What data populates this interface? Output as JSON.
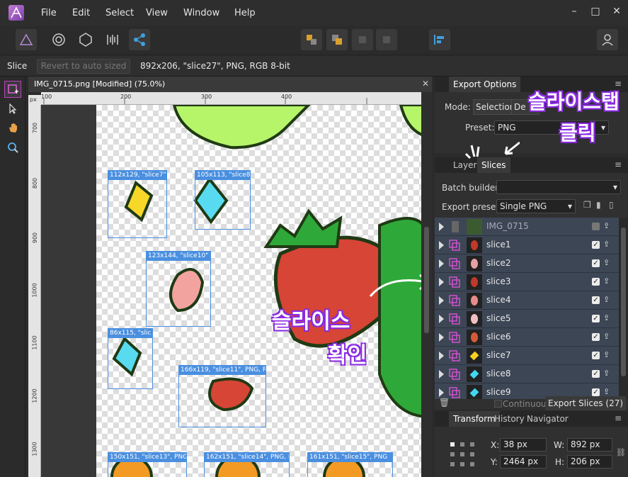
{
  "menu": {
    "items": [
      "File",
      "Edit",
      "Select",
      "View",
      "Window",
      "Help"
    ],
    "window_controls": [
      "–",
      "□",
      "✕"
    ]
  },
  "context": {
    "tool_name": "Slice",
    "revert_label": "Revert to auto sized",
    "info": "892x206, \"slice27\", PNG, RGB 8-bit"
  },
  "document": {
    "tab_title": "IMG_0715.png [Modified] (75.0%)",
    "close_glyph": "✕",
    "ruler_unit": "px",
    "ruler_top": [
      "100",
      "200",
      "300",
      "400"
    ],
    "ruler_left": [
      "700",
      "800",
      "900",
      "1000",
      "1100",
      "1200",
      "1300"
    ],
    "slices": [
      {
        "label": "112x129, \"slice7\""
      },
      {
        "label": "105x113, \"slice8\""
      },
      {
        "label": "123x144, \"slice10\""
      },
      {
        "label": "86x115, \"slic"
      },
      {
        "label": "166x119, \"slice11\", PNG, R"
      },
      {
        "label": "150x151, \"slice13\", PNG"
      },
      {
        "label": "162x151, \"slice14\", PNG, F"
      },
      {
        "label": "161x151, \"slice15\", PNG"
      }
    ]
  },
  "export_options": {
    "tab": "Export Options",
    "mode_label": "Mode:",
    "mode_value": "Selection",
    "mode_value2": "De",
    "preset_label": "Preset:",
    "preset_value": "PNG"
  },
  "slices_panel": {
    "tabs": [
      "Layers",
      "Slices"
    ],
    "batch_label": "Batch builder:",
    "export_preset_label": "Export preset:",
    "export_preset_value": "Single PNG",
    "rows": [
      {
        "name": "IMG_0715",
        "checked": false,
        "color": "#666"
      },
      {
        "name": "slice1",
        "checked": true,
        "color": "#c0392b"
      },
      {
        "name": "slice2",
        "checked": true,
        "color": "#e8a0a0"
      },
      {
        "name": "slice3",
        "checked": true,
        "color": "#c0392b"
      },
      {
        "name": "slice4",
        "checked": true,
        "color": "#e88a8a"
      },
      {
        "name": "slice5",
        "checked": true,
        "color": "#f0c0c0"
      },
      {
        "name": "slice6",
        "checked": true,
        "color": "#d45a3a"
      },
      {
        "name": "slice7",
        "checked": true,
        "color": "#f5d020"
      },
      {
        "name": "slice8",
        "checked": true,
        "color": "#40d8f0"
      },
      {
        "name": "slice9",
        "checked": true,
        "color": "#40d8f0"
      }
    ],
    "continuous_label": "Continuous",
    "export_button": "Export Slices (27)"
  },
  "transform": {
    "tabs": [
      "Transform",
      "History",
      "Navigator"
    ],
    "x_label": "X:",
    "x_value": "38 px",
    "y_label": "Y:",
    "y_value": "2464 px",
    "w_label": "W:",
    "w_value": "892 px",
    "h_label": "H:",
    "h_value": "206 px"
  },
  "annotations": {
    "top": "슬라이스탭",
    "top2": "클릭",
    "middle": "슬라이스",
    "middle2": "확인"
  }
}
